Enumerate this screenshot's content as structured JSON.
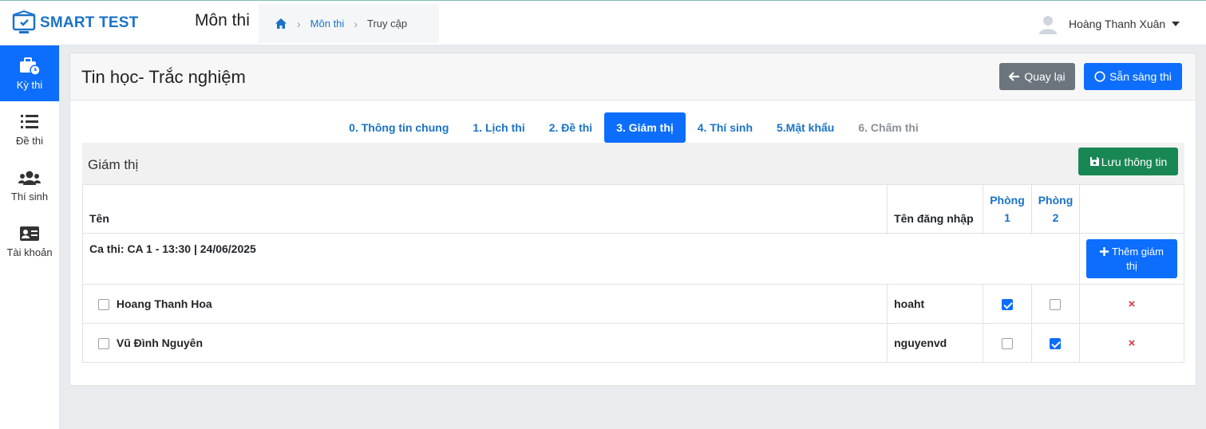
{
  "brand": {
    "name": "SMART TEST",
    "color": "#1a73c8"
  },
  "header": {
    "title": "Môn thi",
    "breadcrumb": [
      {
        "icon": "home-icon"
      },
      {
        "label": "Môn thi"
      },
      {
        "label": "Truy cập"
      }
    ],
    "user_name": "Hoàng Thanh Xuân"
  },
  "sidebar": {
    "items": [
      {
        "label": "Kỳ thi",
        "icon": "briefcase-clock-icon",
        "active": true
      },
      {
        "label": "Đề thi",
        "icon": "list-icon"
      },
      {
        "label": "Thí sinh",
        "icon": "users-icon"
      },
      {
        "label": "Tài khoản",
        "icon": "id-card-icon"
      }
    ]
  },
  "card": {
    "title": "Tin học- Trắc nghiệm",
    "back_label": "Quay lại",
    "ready_label": "Sẵn sàng thi"
  },
  "tabs": [
    {
      "label": "0. Thông tin chung"
    },
    {
      "label": "1. Lịch thi"
    },
    {
      "label": "2. Đề thi"
    },
    {
      "label": "3. Giám thị",
      "active": true
    },
    {
      "label": "4. Thí sinh"
    },
    {
      "label": "5.Mật khẩu"
    },
    {
      "label": "6. Chấm thi",
      "disabled": true
    }
  ],
  "panel": {
    "title": "Giám thị",
    "save_label": "Lưu thông tin",
    "columns": {
      "name": "Tên",
      "username": "Tên đăng nhập",
      "room1_line1": "Phòng",
      "room1_line2": "1",
      "room2_line1": "Phòng",
      "room2_line2": "2"
    },
    "session_label": "Ca thi: CA 1 - 13:30 | 24/06/2025",
    "add_label_line1": "Thêm giám",
    "add_label_line2": "thị",
    "rows": [
      {
        "name": "Hoang Thanh Hoa",
        "username": "hoaht",
        "room1": true,
        "room2": false,
        "delete": "×"
      },
      {
        "name": "Vũ Đình Nguyên",
        "username": "nguyenvd",
        "room1": false,
        "room2": true,
        "delete": "×"
      }
    ]
  },
  "colors": {
    "primary": "#0d6efd",
    "success": "#198754",
    "secondary": "#6c757d",
    "danger": "#dc3545"
  }
}
